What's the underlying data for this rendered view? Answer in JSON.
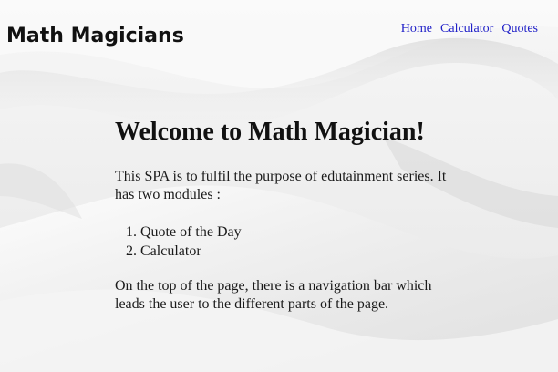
{
  "header": {
    "brand": "Math Magicians",
    "nav": [
      {
        "label": "Home"
      },
      {
        "label": "Calculator"
      },
      {
        "label": "Quotes"
      }
    ]
  },
  "main": {
    "heading": "Welcome to Math Magician!",
    "intro": "This SPA is to fulfil the purpose of edutainment series. It has two modules :",
    "modules": [
      "Quote of the Day",
      "Calculator"
    ],
    "outro": "On the top of the page, there is a navigation bar which leads the user to the different parts of the page."
  },
  "colors": {
    "link": "#2020c8",
    "text": "#1a1a1a",
    "background": "#efefef"
  }
}
